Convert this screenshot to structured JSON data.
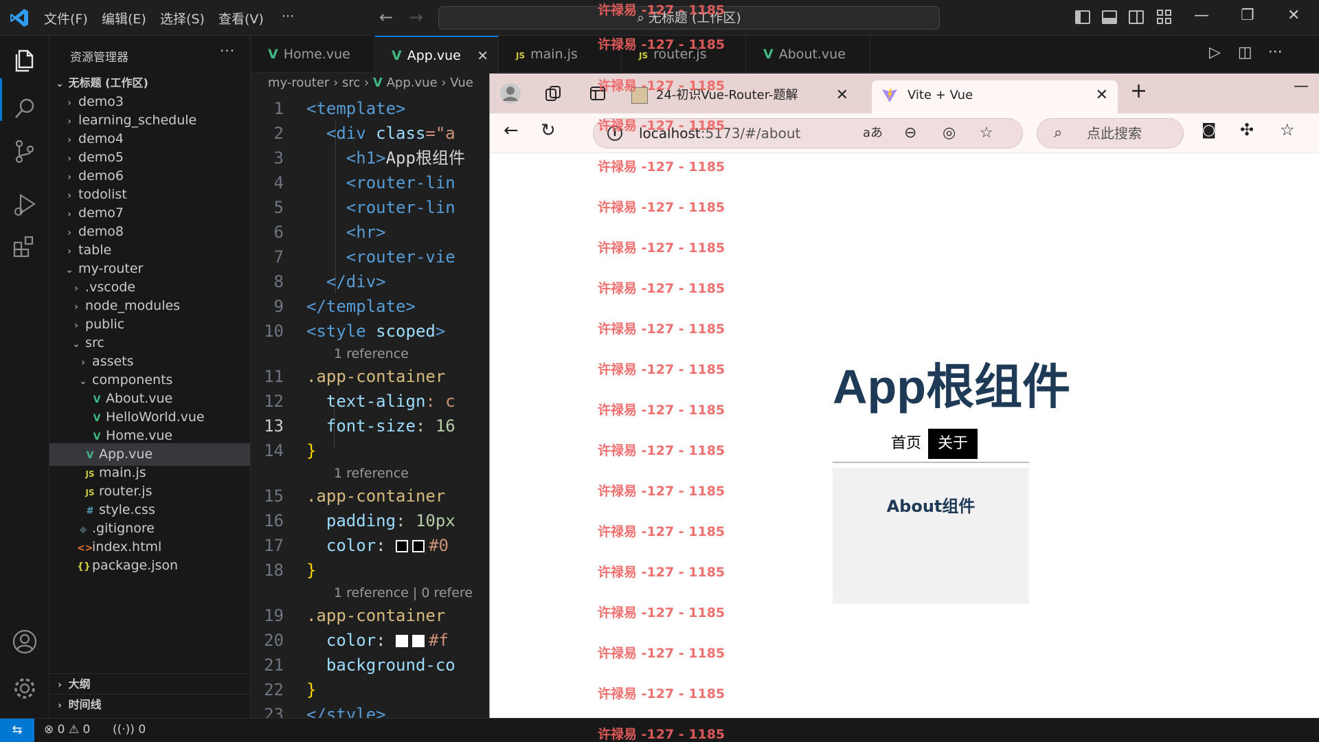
{
  "titlebar": {
    "menus": [
      "文件(F)",
      "编辑(E)",
      "选择(S)",
      "查看(V)",
      "···"
    ],
    "command_center": "无标题 (工作区)"
  },
  "sidebar": {
    "title": "资源管理器",
    "more": "···",
    "workspace": "无标题 (工作区)",
    "items": [
      {
        "label": "demo3",
        "kind": "folder"
      },
      {
        "label": "learning_schedule",
        "kind": "folder"
      },
      {
        "label": "demo4",
        "kind": "folder"
      },
      {
        "label": "demo5",
        "kind": "folder"
      },
      {
        "label": "demo6",
        "kind": "folder"
      },
      {
        "label": "todolist",
        "kind": "folder"
      },
      {
        "label": "demo7",
        "kind": "folder"
      },
      {
        "label": "demo8",
        "kind": "folder"
      },
      {
        "label": "table",
        "kind": "folder"
      },
      {
        "label": "my-router",
        "kind": "folder-open"
      },
      {
        "label": ".vscode",
        "kind": "folder"
      },
      {
        "label": "node_modules",
        "kind": "folder"
      },
      {
        "label": "public",
        "kind": "folder"
      },
      {
        "label": "src",
        "kind": "folder-open"
      },
      {
        "label": "assets",
        "kind": "folder"
      },
      {
        "label": "components",
        "kind": "folder-open"
      },
      {
        "label": "About.vue",
        "kind": "vue"
      },
      {
        "label": "HelloWorld.vue",
        "kind": "vue"
      },
      {
        "label": "Home.vue",
        "kind": "vue"
      },
      {
        "label": "App.vue",
        "kind": "vue"
      },
      {
        "label": "main.js",
        "kind": "js"
      },
      {
        "label": "router.js",
        "kind": "js"
      },
      {
        "label": "style.css",
        "kind": "css"
      },
      {
        "label": ".gitignore",
        "kind": "git"
      },
      {
        "label": "index.html",
        "kind": "html"
      },
      {
        "label": "package.json",
        "kind": "json"
      }
    ],
    "outline": "大纲",
    "timeline": "时间线"
  },
  "tabs": [
    {
      "label": "Home.vue",
      "icon": "V"
    },
    {
      "label": "App.vue",
      "icon": "V"
    },
    {
      "label": "main.js",
      "icon": "JS"
    },
    {
      "label": "router.js",
      "icon": "JS"
    },
    {
      "label": "About.vue",
      "icon": "V"
    }
  ],
  "breadcrumb": {
    "p1": "my-router",
    "p2": "src",
    "p3": "App.vue",
    "p4": "Vue"
  },
  "code": {
    "l1": "<template>",
    "l2_a": "<div ",
    "l2_b": "class",
    "l2_c": "=\"a",
    "l3_a": "<h1>",
    "l3_b": "App根组件",
    "l4": "<router-lin",
    "l5": "<router-lin",
    "l6": "<hr>",
    "l7": "<router-vie",
    "l8": "</div>",
    "l9": "</template>",
    "l10_a": "<style ",
    "l10_b": "scoped",
    "l10_c": ">",
    "lens1": "1 reference",
    "l11": ".app-container",
    "l12_a": "text-align",
    "l12_b": ": c",
    "l13_a": "font-size",
    "l13_b": ": 16",
    "l14": "}",
    "lens2": "1 reference",
    "l15": ".app-container",
    "l16_a": "padding",
    "l16_b": ": 10px",
    "l17_a": "color",
    "l17_b": "#0",
    "l18": "}",
    "lens3": "1 reference | 0 refere",
    "l19": ".app-container",
    "l20_a": "color",
    "l20_b": "#f",
    "l21_a": "background-co",
    "l22": "}",
    "l23": "</style>"
  },
  "line_numbers": [
    "1",
    "2",
    "3",
    "4",
    "5",
    "6",
    "7",
    "8",
    "9",
    "10",
    "11",
    "12",
    "13",
    "14",
    "15",
    "16",
    "17",
    "18",
    "19",
    "20",
    "21",
    "22",
    "23"
  ],
  "statusbar": {
    "errors": "0",
    "warnings": "0",
    "ports": "0"
  },
  "browser": {
    "tab1_title": "24-初识Vue-Router-题解",
    "tab2_title": "Vite + Vue",
    "address_host": "localhost",
    "address_rest": ":5173/#/about",
    "search_placeholder": "点此搜索"
  },
  "page": {
    "title": "App根组件",
    "nav": [
      "首页",
      "关于"
    ],
    "about": "About组件"
  },
  "watermark": "许禄易 -127 - 1185",
  "colors": {
    "accent": "#0078d4",
    "vue_green": "#41b883",
    "title_color": "#1e3a56",
    "watermark": "#ef6060"
  }
}
